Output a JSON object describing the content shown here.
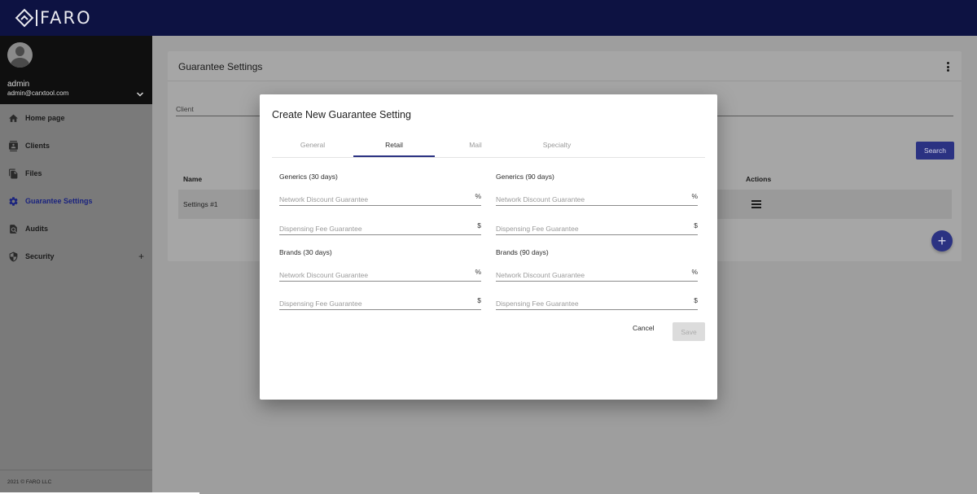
{
  "app": {
    "brand": "FARO"
  },
  "profile": {
    "name": "admin",
    "email": "admin@carxtool.com"
  },
  "sidebar": {
    "items": [
      {
        "label": "Home page",
        "icon": "home-icon"
      },
      {
        "label": "Clients",
        "icon": "contacts-icon"
      },
      {
        "label": "Files",
        "icon": "files-icon"
      },
      {
        "label": "Guarantee Settings",
        "icon": "gear-icon",
        "active": true
      },
      {
        "label": "Audits",
        "icon": "audit-search-icon"
      },
      {
        "label": "Security",
        "icon": "shield-icon",
        "expand": "+"
      }
    ],
    "footer": "2021 © FARO LLC"
  },
  "page": {
    "title": "Guarantee Settings",
    "filter_label": "Client",
    "search_button": "Search",
    "table": {
      "headers": {
        "name": "Name",
        "actions": "Actions"
      },
      "rows": [
        {
          "name": "Settings #1"
        }
      ]
    },
    "fab_label": "+"
  },
  "modal": {
    "title": "Create New Guarantee Setting",
    "tabs": [
      "General",
      "Retail",
      "Mail",
      "Specialty"
    ],
    "active_tab": "Retail",
    "sections": {
      "generics30": "Generics (30 days)",
      "generics90": "Generics (90 days)",
      "brands30": "Brands (30 days)",
      "brands90": "Brands (90 days)"
    },
    "fields": {
      "network_placeholder": "Network Discount Guarantee",
      "dispensing_placeholder": "Dispensing Fee Guarantee",
      "percent_suffix": "%",
      "dollar_suffix": "$"
    },
    "cancel_label": "Cancel",
    "save_label": "Save"
  },
  "colors": {
    "topbar": "#0d1242",
    "accent": "#2b3282",
    "active_tab_underline": "#2b3282"
  }
}
